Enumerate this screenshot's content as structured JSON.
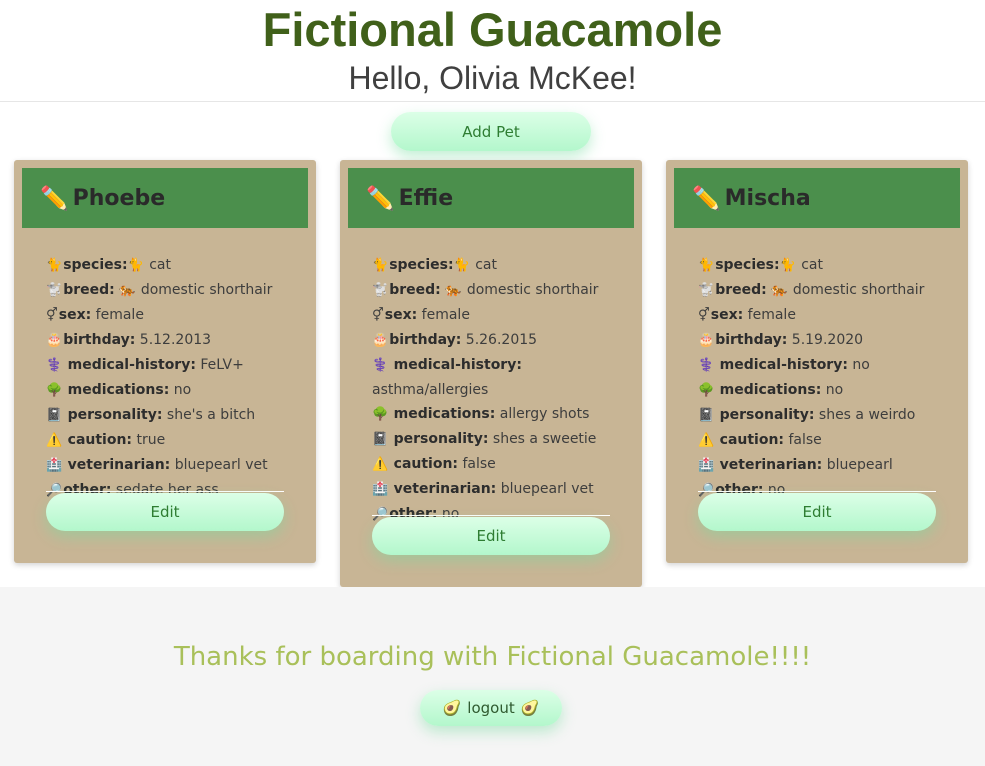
{
  "app": {
    "title": "Fictional Guacamole",
    "greeting": "Hello, Olivia McKee!"
  },
  "actions": {
    "add_pet": "Add Pet",
    "edit": "Edit"
  },
  "icons": {
    "pencil": "✏️",
    "species": "🐈",
    "breed": "🐩",
    "breed_value": "🐅",
    "sex": "⚥",
    "birthday": "🎂",
    "medical": "⚕️",
    "medications": "🌳",
    "personality": "📓",
    "caution": "⚠️",
    "veterinarian": "🏥",
    "other": "🔎",
    "avocado": "🥑"
  },
  "labels": {
    "species": "species:",
    "breed": "breed:",
    "sex": "sex:",
    "birthday": "birthday:",
    "medical": "medical-history:",
    "medications": "medications:",
    "personality": "personality:",
    "caution": "caution:",
    "veterinarian": "veterinarian:",
    "other": "other:"
  },
  "pets": [
    {
      "name": "Phoebe",
      "species": "cat",
      "breed": "domestic shorthair",
      "sex": "female",
      "birthday": "5.12.2013",
      "medical": "FeLV+",
      "medications": "no",
      "personality": "she's a bitch",
      "caution": "true",
      "veterinarian": "bluepearl vet",
      "other": "sedate her ass"
    },
    {
      "name": "Effie",
      "species": "cat",
      "breed": "domestic shorthair",
      "sex": "female",
      "birthday": "5.26.2015",
      "medical": "asthma/allergies",
      "medications": "allergy shots",
      "personality": "shes a sweetie",
      "caution": "false",
      "veterinarian": "bluepearl vet",
      "other": "no"
    },
    {
      "name": "Mischa",
      "species": "cat",
      "breed": "domestic shorthair",
      "sex": "female",
      "birthday": "5.19.2020",
      "medical": "no",
      "medications": "no",
      "personality": "shes a weirdo",
      "caution": "false",
      "veterinarian": "bluepearl",
      "other": "no"
    }
  ],
  "footer": {
    "thanks": "Thanks for boarding with Fictional Guacamole!!!!",
    "logout": "logout"
  }
}
